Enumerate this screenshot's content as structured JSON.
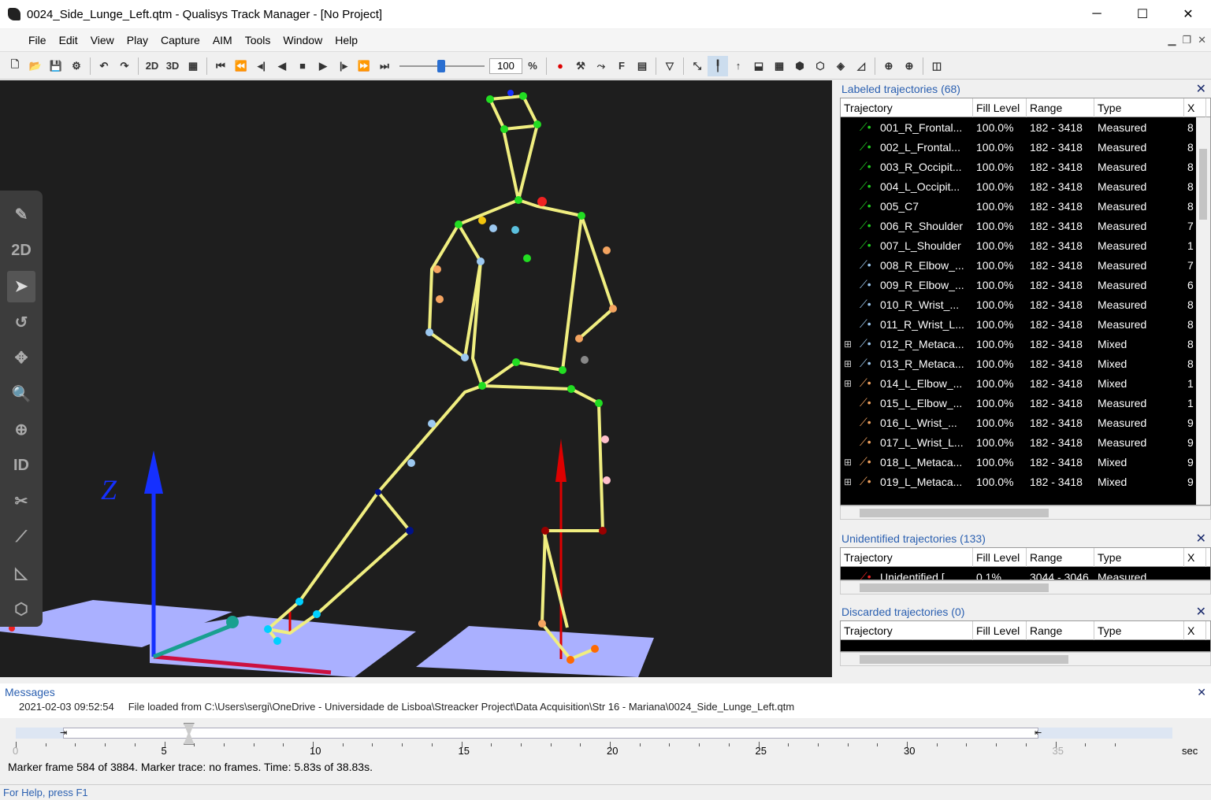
{
  "window": {
    "title": "0024_Side_Lunge_Left.qtm - Qualisys Track Manager - [No Project]",
    "minimize": "─",
    "maximize": "☐",
    "close": "✕"
  },
  "menu": [
    "File",
    "Edit",
    "View",
    "Play",
    "Capture",
    "AIM",
    "Tools",
    "Window",
    "Help"
  ],
  "toolbar": {
    "zoom_value": "100",
    "zoom_unit": "%",
    "label_2d": "2D",
    "label_3d": "3D",
    "label_f": "F"
  },
  "tools": {
    "label_2d": "2D",
    "label_id": "ID"
  },
  "labeled": {
    "title": "Labeled trajectories (68)",
    "columns": [
      "Trajectory",
      "Fill Level",
      "Range",
      "Type",
      "X"
    ],
    "rows": [
      {
        "name": "001_R_Frontal...",
        "fill": "100.0%",
        "range": "182 - 3418",
        "type": "Measured",
        "x": "8",
        "color": "#22cc22",
        "expand": ""
      },
      {
        "name": "002_L_Frontal...",
        "fill": "100.0%",
        "range": "182 - 3418",
        "type": "Measured",
        "x": "8",
        "color": "#22cc22",
        "expand": ""
      },
      {
        "name": "003_R_Occipit...",
        "fill": "100.0%",
        "range": "182 - 3418",
        "type": "Measured",
        "x": "8",
        "color": "#22cc22",
        "expand": ""
      },
      {
        "name": "004_L_Occipit...",
        "fill": "100.0%",
        "range": "182 - 3418",
        "type": "Measured",
        "x": "8",
        "color": "#22cc22",
        "expand": ""
      },
      {
        "name": "005_C7",
        "fill": "100.0%",
        "range": "182 - 3418",
        "type": "Measured",
        "x": "8",
        "color": "#22cc22",
        "expand": ""
      },
      {
        "name": "006_R_Shoulder",
        "fill": "100.0%",
        "range": "182 - 3418",
        "type": "Measured",
        "x": "7",
        "color": "#22cc22",
        "expand": ""
      },
      {
        "name": "007_L_Shoulder",
        "fill": "100.0%",
        "range": "182 - 3418",
        "type": "Measured",
        "x": "1",
        "color": "#22cc22",
        "expand": ""
      },
      {
        "name": "008_R_Elbow_...",
        "fill": "100.0%",
        "range": "182 - 3418",
        "type": "Measured",
        "x": "7",
        "color": "#9cc8f0",
        "expand": ""
      },
      {
        "name": "009_R_Elbow_...",
        "fill": "100.0%",
        "range": "182 - 3418",
        "type": "Measured",
        "x": "6",
        "color": "#9cc8f0",
        "expand": ""
      },
      {
        "name": "010_R_Wrist_...",
        "fill": "100.0%",
        "range": "182 - 3418",
        "type": "Measured",
        "x": "8",
        "color": "#9cc8f0",
        "expand": ""
      },
      {
        "name": "011_R_Wrist_L...",
        "fill": "100.0%",
        "range": "182 - 3418",
        "type": "Measured",
        "x": "8",
        "color": "#9cc8f0",
        "expand": ""
      },
      {
        "name": "012_R_Metaca...",
        "fill": "100.0%",
        "range": "182 - 3418",
        "type": "Mixed",
        "x": "8",
        "color": "#9cc8f0",
        "expand": "⊞"
      },
      {
        "name": "013_R_Metaca...",
        "fill": "100.0%",
        "range": "182 - 3418",
        "type": "Mixed",
        "x": "8",
        "color": "#9cc8f0",
        "expand": "⊞"
      },
      {
        "name": "014_L_Elbow_...",
        "fill": "100.0%",
        "range": "182 - 3418",
        "type": "Mixed",
        "x": "1",
        "color": "#f4a460",
        "expand": "⊞"
      },
      {
        "name": "015_L_Elbow_...",
        "fill": "100.0%",
        "range": "182 - 3418",
        "type": "Measured",
        "x": "1",
        "color": "#f4a460",
        "expand": ""
      },
      {
        "name": "016_L_Wrist_...",
        "fill": "100.0%",
        "range": "182 - 3418",
        "type": "Measured",
        "x": "9",
        "color": "#f4a460",
        "expand": ""
      },
      {
        "name": "017_L_Wrist_L...",
        "fill": "100.0%",
        "range": "182 - 3418",
        "type": "Measured",
        "x": "9",
        "color": "#f4a460",
        "expand": ""
      },
      {
        "name": "018_L_Metaca...",
        "fill": "100.0%",
        "range": "182 - 3418",
        "type": "Mixed",
        "x": "9",
        "color": "#f4a460",
        "expand": "⊞"
      },
      {
        "name": "019_L_Metaca...",
        "fill": "100.0%",
        "range": "182 - 3418",
        "type": "Mixed",
        "x": "9",
        "color": "#f4a460",
        "expand": "⊞"
      }
    ]
  },
  "unidentified": {
    "title": "Unidentified trajectories (133)",
    "columns": [
      "Trajectory",
      "Fill Level",
      "Range",
      "Type",
      "X"
    ],
    "rows": [
      {
        "name": "Unidentified [...",
        "fill": "0.1%",
        "range": "3044 - 3046",
        "type": "Measured",
        "x": "",
        "color": "#ee2222",
        "expand": ""
      }
    ]
  },
  "discarded": {
    "title": "Discarded trajectories (0)",
    "columns": [
      "Trajectory",
      "Fill Level",
      "Range",
      "Type",
      "X"
    ]
  },
  "messages": {
    "title": "Messages",
    "timestamp": "2021-02-03 09:52:54",
    "text": "File loaded from C:\\Users\\sergi\\OneDrive - Universidade de Lisboa\\Streacker Project\\Data Acquisition\\Str 16 - Mariana\\0024_Side_Lunge_Left.qtm"
  },
  "timeline": {
    "ticks": [
      "0",
      "5",
      "10",
      "15",
      "20",
      "25",
      "30",
      "35"
    ],
    "unit": "sec",
    "current": 5.83,
    "total": 38.83,
    "status": "Marker frame 584 of 3884. Marker trace: no frames. Time: 5.83s of 38.83s."
  },
  "statusbar": "For Help, press F1",
  "viewport": {
    "axis_label": "Z"
  }
}
